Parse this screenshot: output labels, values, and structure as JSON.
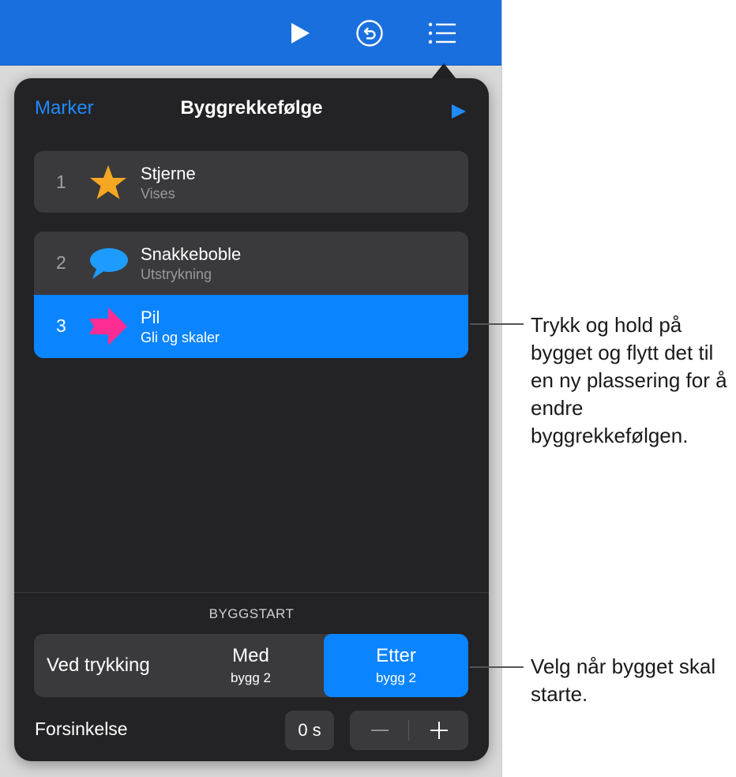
{
  "toolbar": {
    "play_icon": "play-icon",
    "undo_icon": "undo-icon",
    "list_icon": "list-icon"
  },
  "popover": {
    "left_button": "Marker",
    "title": "Byggrekkefølge",
    "play_icon": "play-icon"
  },
  "builds": [
    {
      "number": "1",
      "name": "Stjerne",
      "effect": "Vises",
      "icon": "star-icon",
      "color": "#f5a623"
    },
    {
      "number": "2",
      "name": "Snakkeboble",
      "effect": "Utstrykning",
      "icon": "speech-bubble-icon",
      "color": "#1e9bff"
    },
    {
      "number": "3",
      "name": "Pil",
      "effect": "Gli og skaler",
      "icon": "arrow-icon",
      "color": "#ff2d93",
      "selected": true
    }
  ],
  "build_start": {
    "section_label": "BYGGSTART",
    "options": {
      "on_tap": "Ved trykking",
      "with_main": "Med",
      "with_sub": "bygg 2",
      "after_main": "Etter",
      "after_sub": "bygg 2"
    },
    "selected": "after"
  },
  "delay": {
    "label": "Forsinkelse",
    "value": "0 s",
    "minus": "−",
    "plus": "+"
  },
  "callouts": {
    "reorder": "Trykk og hold på bygget og flytt det til en ny plassering for å endre byggrekkefølgen.",
    "start": "Velg når bygget skal starte."
  },
  "colors": {
    "toolbar": "#1a6fde",
    "accent": "#0a84ff",
    "popover_bg": "#232325",
    "card_bg": "#3a3a3c"
  }
}
